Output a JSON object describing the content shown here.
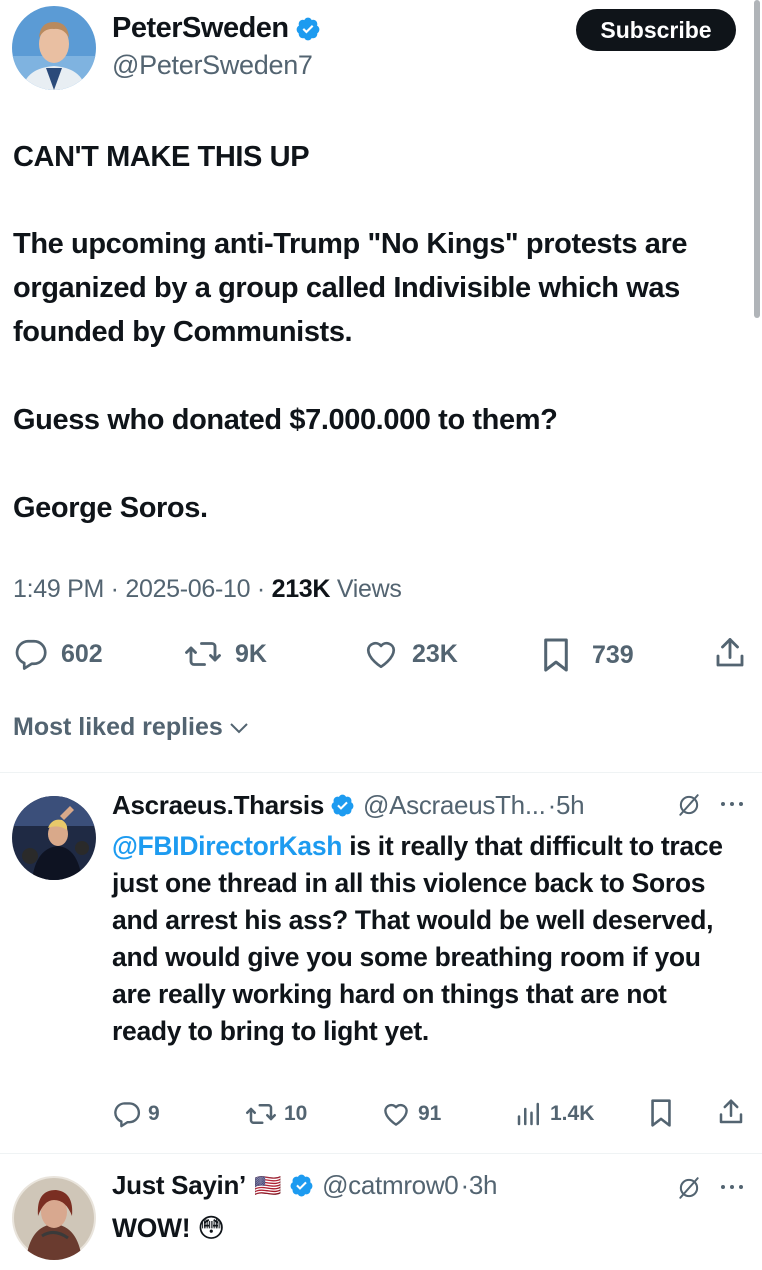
{
  "tweet": {
    "author_name": "PeterSweden",
    "author_handle": "@PeterSweden7",
    "subscribe_label": "Subscribe",
    "lines": [
      "CAN'T MAKE THIS UP",
      "The upcoming anti-Trump \"No Kings\" protests are organized by a group called Indivisible which was founded by Communists.",
      "Guess who donated $7.000.000 to them?",
      "George Soros."
    ],
    "time": "1:49 PM",
    "date": "2025-06-10",
    "views_count": "213K",
    "views_label": "Views",
    "actions": {
      "replies": "602",
      "reposts": "9K",
      "likes": "23K",
      "bookmarks": "739"
    }
  },
  "replies_sort_label": "Most liked replies",
  "replies": [
    {
      "name": "Ascraeus.Tharsis",
      "handle": "@AscraeusTh...",
      "time": "5h",
      "mention": "@FBIDirectorKash",
      "text": " is it really that difficult to trace just one thread in all this violence back to Soros and arrest his ass?  That would be well deserved, and would give you some breathing room if you are really working hard on things that are not ready to bring to light yet.",
      "actions": {
        "replies": "9",
        "reposts": "10",
        "likes": "91",
        "views": "1.4K"
      }
    },
    {
      "name": "Just Sayin’",
      "flag": "🇺🇸",
      "handle": "@catmrow0",
      "time": "3h",
      "text": "WOW! 😳"
    }
  ],
  "colors": {
    "text": "#0f1419",
    "secondary": "#536471",
    "link": "#1d9bf0",
    "verified": "#1d9bf0",
    "button_bg": "#0f1419",
    "divider": "#eff3f4"
  },
  "icons": [
    "verified-badge-icon",
    "reply-icon",
    "repost-icon",
    "like-icon",
    "bookmark-icon",
    "share-icon",
    "views-icon",
    "chevron-down-icon",
    "grok-icon",
    "more-icon"
  ]
}
